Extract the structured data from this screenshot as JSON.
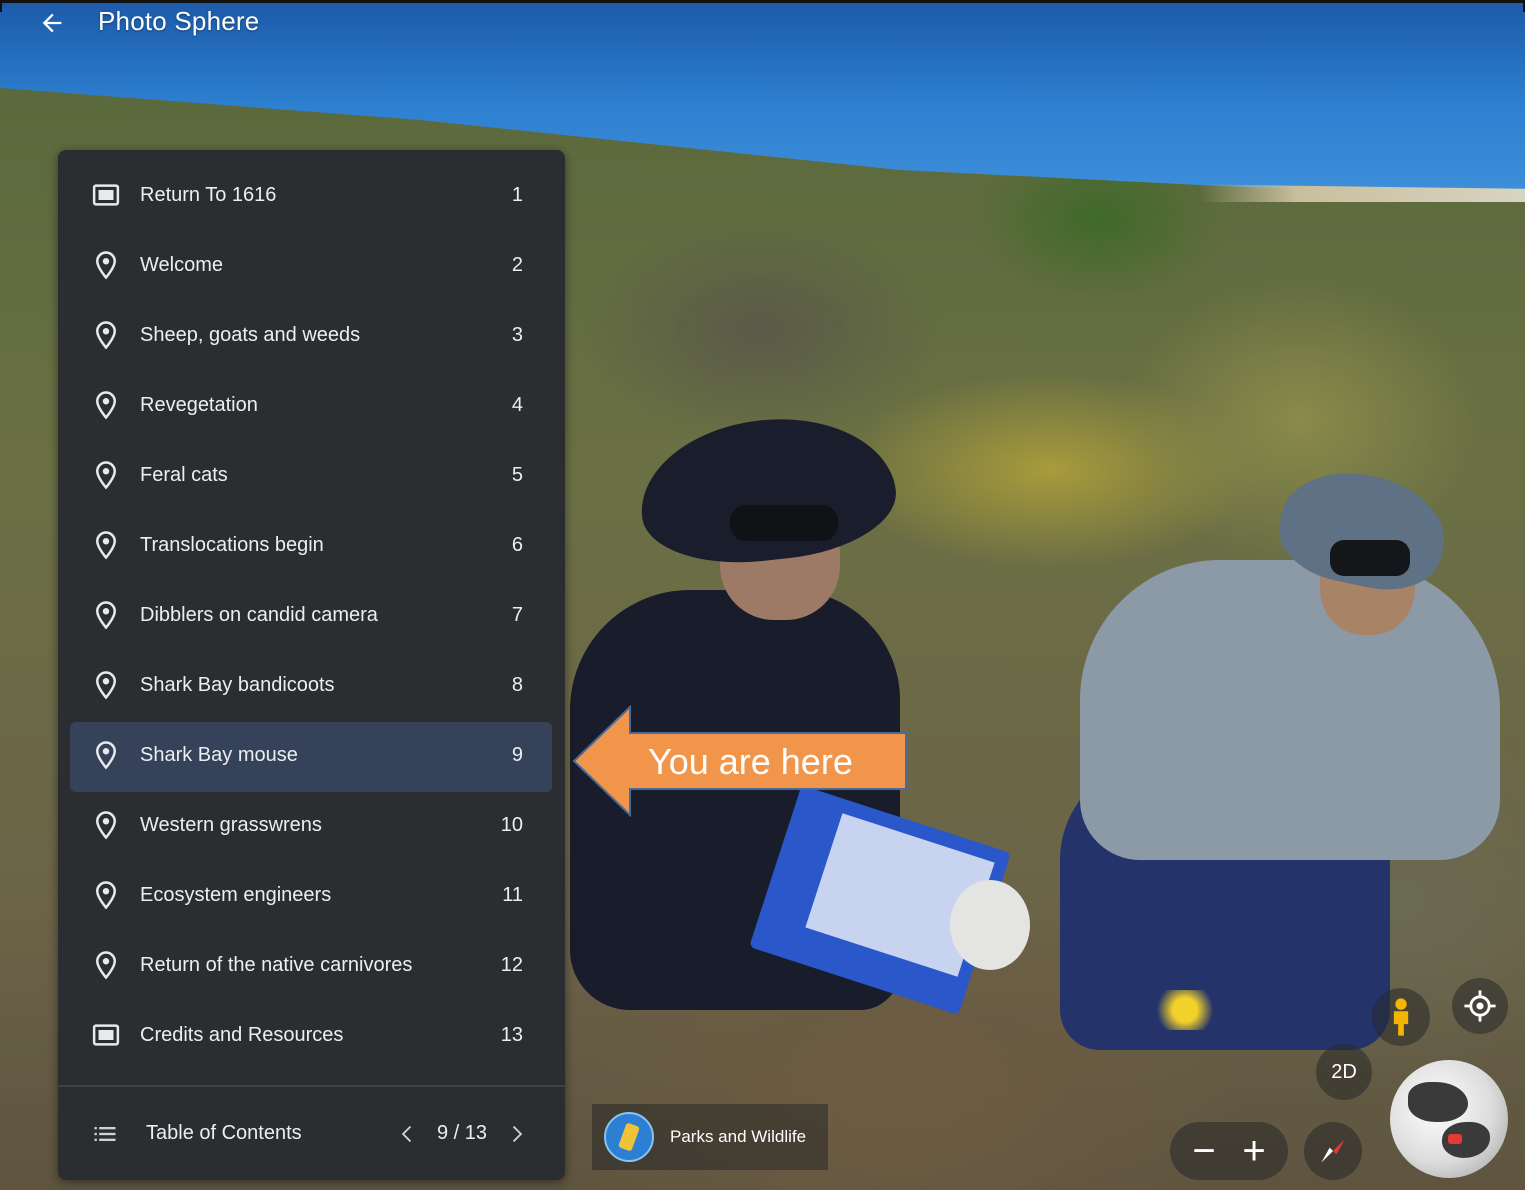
{
  "header": {
    "title": "Photo Sphere"
  },
  "toc": {
    "items": [
      {
        "label": "Return To 1616",
        "num": "1",
        "icon": "slide-icon"
      },
      {
        "label": "Welcome",
        "num": "2",
        "icon": "place-pin-icon"
      },
      {
        "label": "Sheep, goats and weeds",
        "num": "3",
        "icon": "place-pin-icon"
      },
      {
        "label": "Revegetation",
        "num": "4",
        "icon": "place-pin-icon"
      },
      {
        "label": "Feral cats",
        "num": "5",
        "icon": "place-pin-icon"
      },
      {
        "label": "Translocations begin",
        "num": "6",
        "icon": "place-pin-icon"
      },
      {
        "label": "Dibblers on candid camera",
        "num": "7",
        "icon": "place-pin-icon"
      },
      {
        "label": "Shark Bay bandicoots",
        "num": "8",
        "icon": "place-pin-icon"
      },
      {
        "label": "Shark Bay mouse",
        "num": "9",
        "icon": "place-pin-icon",
        "active": true
      },
      {
        "label": "Western grasswrens",
        "num": "10",
        "icon": "place-pin-icon"
      },
      {
        "label": "Ecosystem engineers",
        "num": "11",
        "icon": "place-pin-icon"
      },
      {
        "label": "Return of the native carnivores",
        "num": "12",
        "icon": "place-pin-icon"
      },
      {
        "label": "Credits and Resources",
        "num": "13",
        "icon": "slide-icon"
      }
    ],
    "footer_label": "Table of Contents",
    "pager_text": "9 / 13"
  },
  "callout": {
    "text": "You are here"
  },
  "attribution": {
    "text": "Parks and Wildlife"
  },
  "controls": {
    "zoom_out": "−",
    "zoom_in": "+",
    "view_2d": "2D"
  },
  "colors": {
    "panel_bg": "#2b2d31",
    "active_row": "#354259",
    "callout": "#f0954a",
    "text": "#eceff1"
  }
}
